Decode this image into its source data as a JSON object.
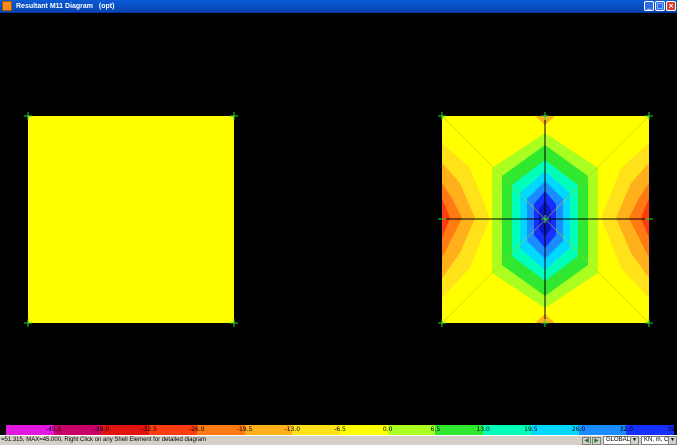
{
  "window": {
    "title": "Resultant M11 Diagram   (opt)",
    "minimize_glyph": "_",
    "maximize_glyph": "□",
    "close_glyph": "×"
  },
  "legend": {
    "labels": [
      "-45.5",
      "-39.0",
      "-32.5",
      "-26.0",
      "-19.5",
      "-13.0",
      "-6.5",
      "0.0",
      "6.5",
      "13.0",
      "19.5",
      "26.0",
      "32.0",
      "39.0"
    ],
    "colors": [
      "#e018e0",
      "#c8006a",
      "#e01212",
      "#ff3c10",
      "#ff7a12",
      "#ffb01a",
      "#ffe21a",
      "#ffff00",
      "#aaff20",
      "#30e830",
      "#00ffb8",
      "#00d8ff",
      "#1a8cff",
      "#1630ff"
    ]
  },
  "status": {
    "text": "=51.315, MAX=45.000, Right Click on any Shell Element for detailed diagram",
    "coord_system": "GLOBAL",
    "units": "KN, m, C"
  },
  "diagram": {
    "background": "#000000",
    "left_panel_color": "#ffff00",
    "contour_colors": [
      "#ffff00",
      "#ffe21a",
      "#ffb01a",
      "#ff7a12",
      "#ff3c10",
      "#e01212",
      "#30e830",
      "#00ffb8",
      "#00d8ff",
      "#1a8cff",
      "#1630ff",
      "#0a18c8"
    ]
  }
}
